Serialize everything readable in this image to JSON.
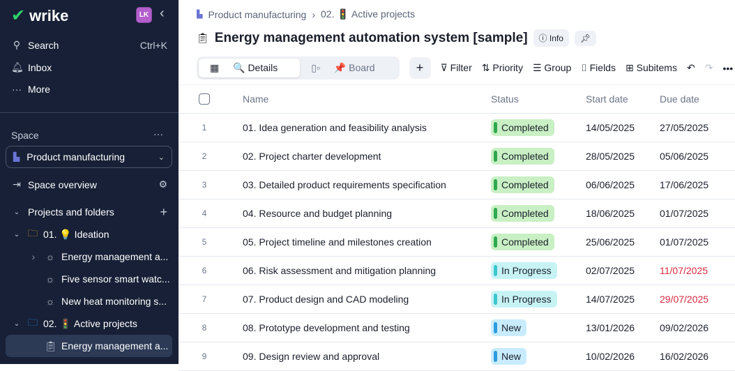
{
  "sidebar": {
    "logo": "wrike",
    "avatar": "LK",
    "search": "Search",
    "search_shortcut": "Ctrl+K",
    "inbox": "Inbox",
    "more": "More",
    "space_label": "Space",
    "space_name": "Product manufacturing",
    "space_overview": "Space overview",
    "projects_label": "Projects and folders",
    "tree": [
      {
        "label": "01. 💡 Ideation",
        "type": "folder",
        "color": "#d4a017"
      },
      {
        "label": "Energy management a...",
        "type": "idea"
      },
      {
        "label": "Five sensor smart watc...",
        "type": "idea"
      },
      {
        "label": "New heat monitoring s...",
        "type": "idea"
      },
      {
        "label": "02. 🚦 Active projects",
        "type": "folder",
        "color": "#2f9be0"
      },
      {
        "label": "Energy management a...",
        "type": "project",
        "selected": true
      }
    ]
  },
  "breadcrumb": [
    "Product manufacturing",
    "02. 🚦 Active projects"
  ],
  "title": "Energy management automation system [sample]",
  "info_label": "Info",
  "toolbar": {
    "details": "🔍 Details",
    "board": "📌 Board",
    "filter": "Filter",
    "priority": "Priority",
    "group": "Group",
    "fields": "Fields",
    "subitems": "Subitems"
  },
  "table": {
    "headers": [
      "Name",
      "Status",
      "Start date",
      "Due date"
    ],
    "rows": [
      {
        "n": "1",
        "name": "01. Idea generation and feasibility analysis",
        "status": "Completed",
        "start": "14/05/2025",
        "due": "27/05/2025",
        "overdue": false
      },
      {
        "n": "2",
        "name": "02. Project charter development",
        "status": "Completed",
        "start": "28/05/2025",
        "due": "05/06/2025",
        "overdue": false
      },
      {
        "n": "3",
        "name": "03. Detailed product requirements specification",
        "status": "Completed",
        "start": "06/06/2025",
        "due": "17/06/2025",
        "overdue": false
      },
      {
        "n": "4",
        "name": "04. Resource and budget planning",
        "status": "Completed",
        "start": "18/06/2025",
        "due": "01/07/2025",
        "overdue": false
      },
      {
        "n": "5",
        "name": "05. Project timeline and milestones creation",
        "status": "Completed",
        "start": "25/06/2025",
        "due": "01/07/2025",
        "overdue": false
      },
      {
        "n": "6",
        "name": "06. Risk assessment and mitigation planning",
        "status": "In Progress",
        "start": "02/07/2025",
        "due": "11/07/2025",
        "overdue": true
      },
      {
        "n": "7",
        "name": "07. Product design and CAD modeling",
        "status": "In Progress",
        "start": "14/07/2025",
        "due": "29/07/2025",
        "overdue": true
      },
      {
        "n": "8",
        "name": "08. Prototype development and testing",
        "status": "New",
        "start": "13/01/2026",
        "due": "09/02/2026",
        "overdue": false
      },
      {
        "n": "9",
        "name": "09. Design review and approval",
        "status": "New",
        "start": "10/02/2026",
        "due": "16/02/2026",
        "overdue": false
      }
    ]
  },
  "status_colors": {
    "Completed": {
      "bg": "#c9f0c4",
      "bar": "#2fa84f"
    },
    "In Progress": {
      "bg": "#c8f3f5",
      "bar": "#3cc7cf"
    },
    "New": {
      "bg": "#c8ecfd",
      "bar": "#2f9be0"
    }
  },
  "overdue_color": "#d6293e"
}
